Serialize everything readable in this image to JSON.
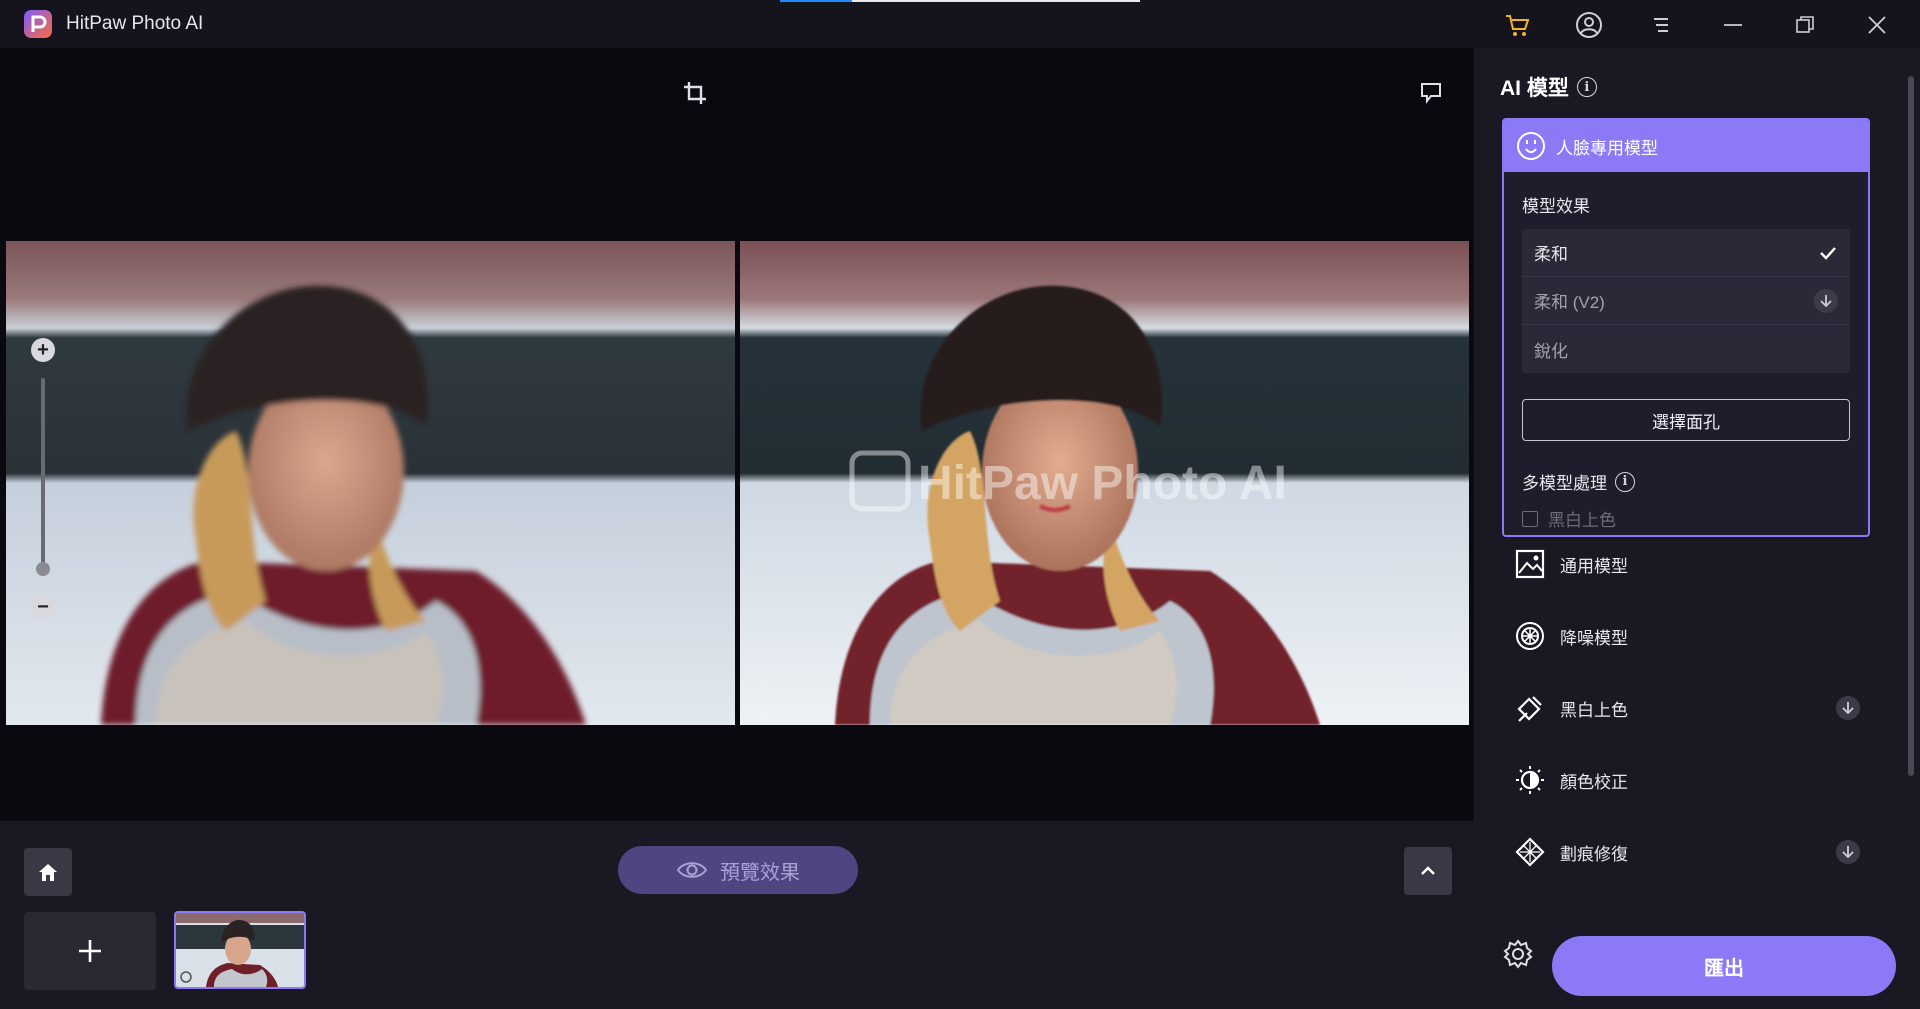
{
  "app": {
    "title": "HitPaw Photo AI",
    "progress": 0.2
  },
  "titlebar": {
    "icons": [
      "cart-icon",
      "account-icon",
      "menu-icon",
      "minimize-icon",
      "restore-icon",
      "close-icon"
    ]
  },
  "canvas": {
    "watermark": "HitPaw Photo AI",
    "icons": [
      "crop-icon",
      "feedback-icon"
    ]
  },
  "bottom": {
    "preview_label": "預覽效果"
  },
  "sidebar": {
    "heading": "AI 模型",
    "face_model": {
      "title": "人臉專用模型",
      "effect_label": "模型效果",
      "options": [
        {
          "label": "柔和",
          "state": "selected"
        },
        {
          "label": "柔和 (V2)",
          "state": "download"
        },
        {
          "label": "銳化",
          "state": "none"
        }
      ],
      "select_face_label": "選擇面孔",
      "multi_label": "多模型處理",
      "colorize_checkbox_label": "黑白上色",
      "colorize_checked": false
    },
    "models": [
      {
        "label": "通用模型",
        "icon": "image-icon",
        "download": false
      },
      {
        "label": "降噪模型",
        "icon": "denoise-icon",
        "download": false
      },
      {
        "label": "黑白上色",
        "icon": "colorize-icon",
        "download": true
      },
      {
        "label": "顏色校正",
        "icon": "sun-icon",
        "download": false
      },
      {
        "label": "劃痕修復",
        "icon": "scratch-repair-icon",
        "download": true
      }
    ],
    "export_label": "匯出"
  },
  "colors": {
    "accent": "#8b79f5",
    "accent_dark": "#4d4680",
    "panel": "#1a1822",
    "canvas": "#0a090f"
  }
}
